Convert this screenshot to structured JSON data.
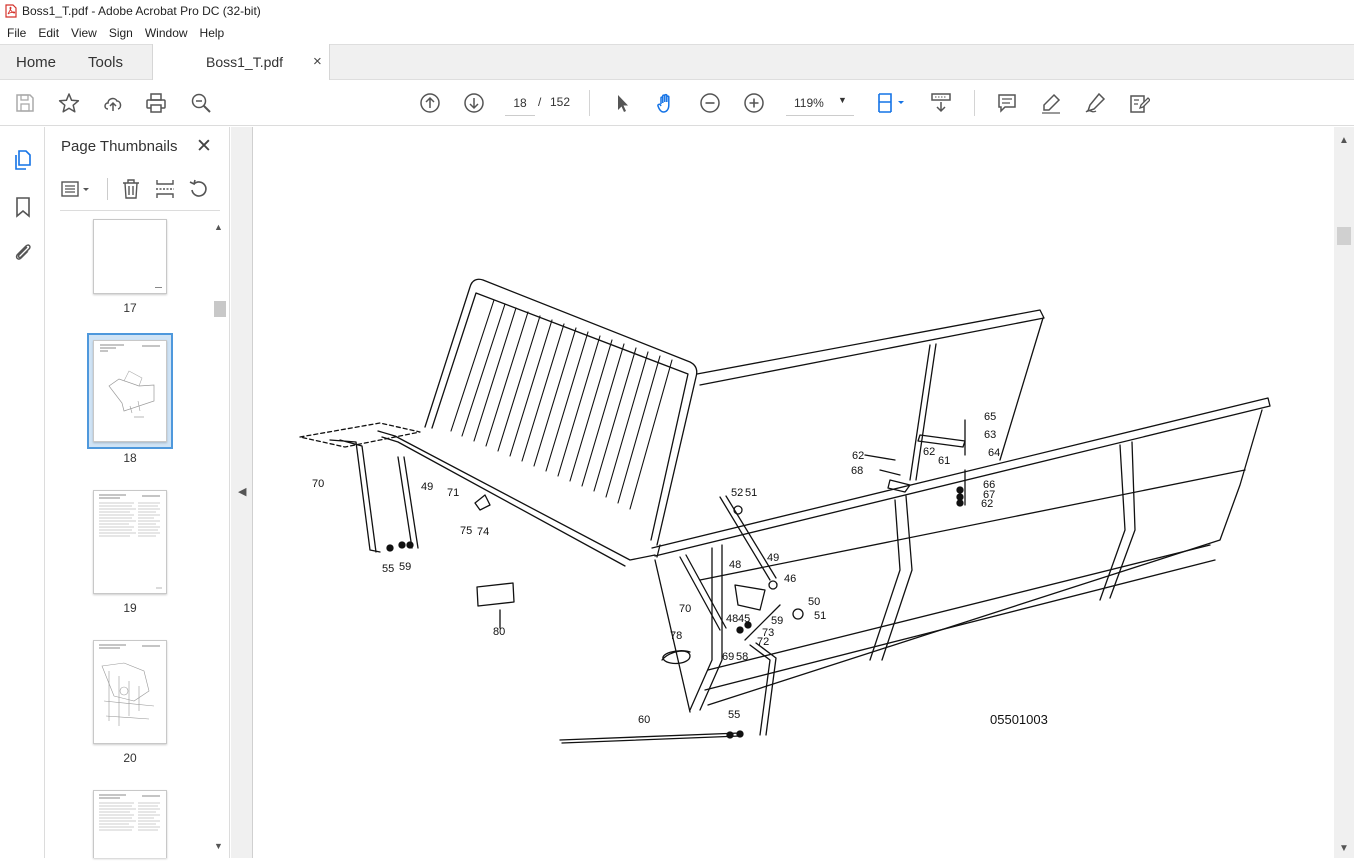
{
  "window": {
    "title": "Boss1_T.pdf - Adobe Acrobat Pro DC (32-bit)"
  },
  "menu": [
    "File",
    "Edit",
    "View",
    "Sign",
    "Window",
    "Help"
  ],
  "tabs": {
    "home": "Home",
    "tools": "Tools",
    "document": "Boss1_T.pdf",
    "close": "×"
  },
  "toolbar": {
    "page_current": "18",
    "page_sep": "/",
    "page_total": "152",
    "zoom": "119%"
  },
  "thumbnails": {
    "title": "Page Thumbnails",
    "close": "✕",
    "pages": [
      "17",
      "18",
      "19",
      "20"
    ],
    "selected": "18"
  },
  "drawing": {
    "code": "05501003",
    "callouts": [
      "70",
      "49",
      "71",
      "75",
      "74",
      "55",
      "59",
      "80",
      "52",
      "51",
      "48",
      "49",
      "46",
      "48",
      "45",
      "59",
      "73",
      "72",
      "50",
      "51",
      "70",
      "78",
      "69",
      "58",
      "60",
      "55",
      "65",
      "63",
      "62",
      "62",
      "61",
      "64",
      "68",
      "66",
      "67",
      "62"
    ]
  },
  "colors": {
    "selection_border": "#4e98dc",
    "selection_fill": "#cfe3f5",
    "toolbar_icon": "#555555"
  }
}
